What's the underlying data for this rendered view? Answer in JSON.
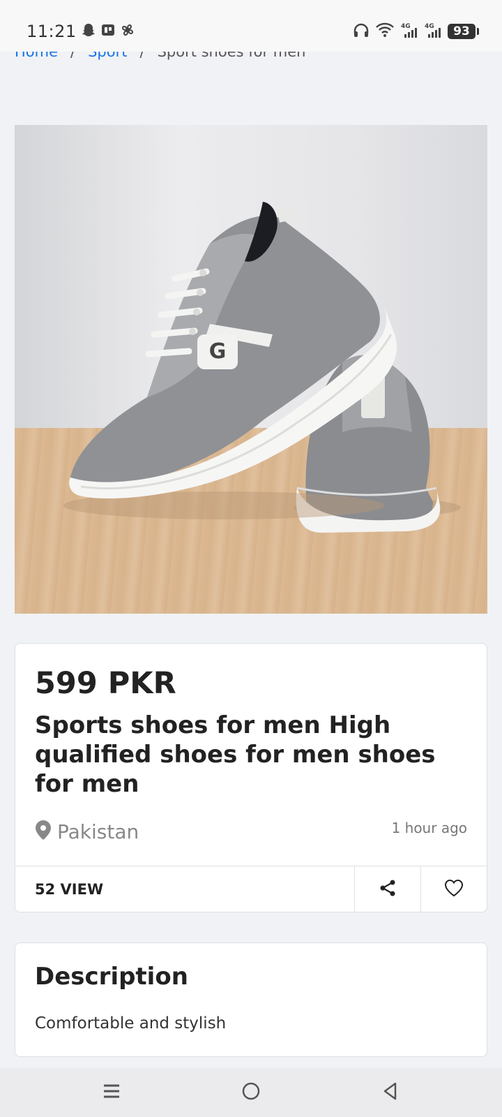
{
  "status_bar": {
    "time": "11:21",
    "battery": "93",
    "network_1": "4G",
    "network_2": "4G"
  },
  "breadcrumb": {
    "home": "Home",
    "category": "Sport",
    "current": "Sport shoes for men",
    "separator": "/"
  },
  "product": {
    "price": "599 PKR",
    "title": "Sports shoes for men High qualified shoes for men shoes for men",
    "location": "Pakistan",
    "posted": "1 hour ago",
    "views": "52 VIEW"
  },
  "description": {
    "heading": "Description",
    "body": "Comfortable and stylish"
  },
  "icons": {
    "location": "map-pin-icon",
    "share": "share-icon",
    "favorite": "heart-icon",
    "nav_menu": "menu-icon",
    "nav_home": "home-circle-icon",
    "nav_back": "back-triangle-icon"
  },
  "colors": {
    "link": "#1a73e8",
    "background": "#f0f2f5",
    "card": "#ffffff"
  }
}
